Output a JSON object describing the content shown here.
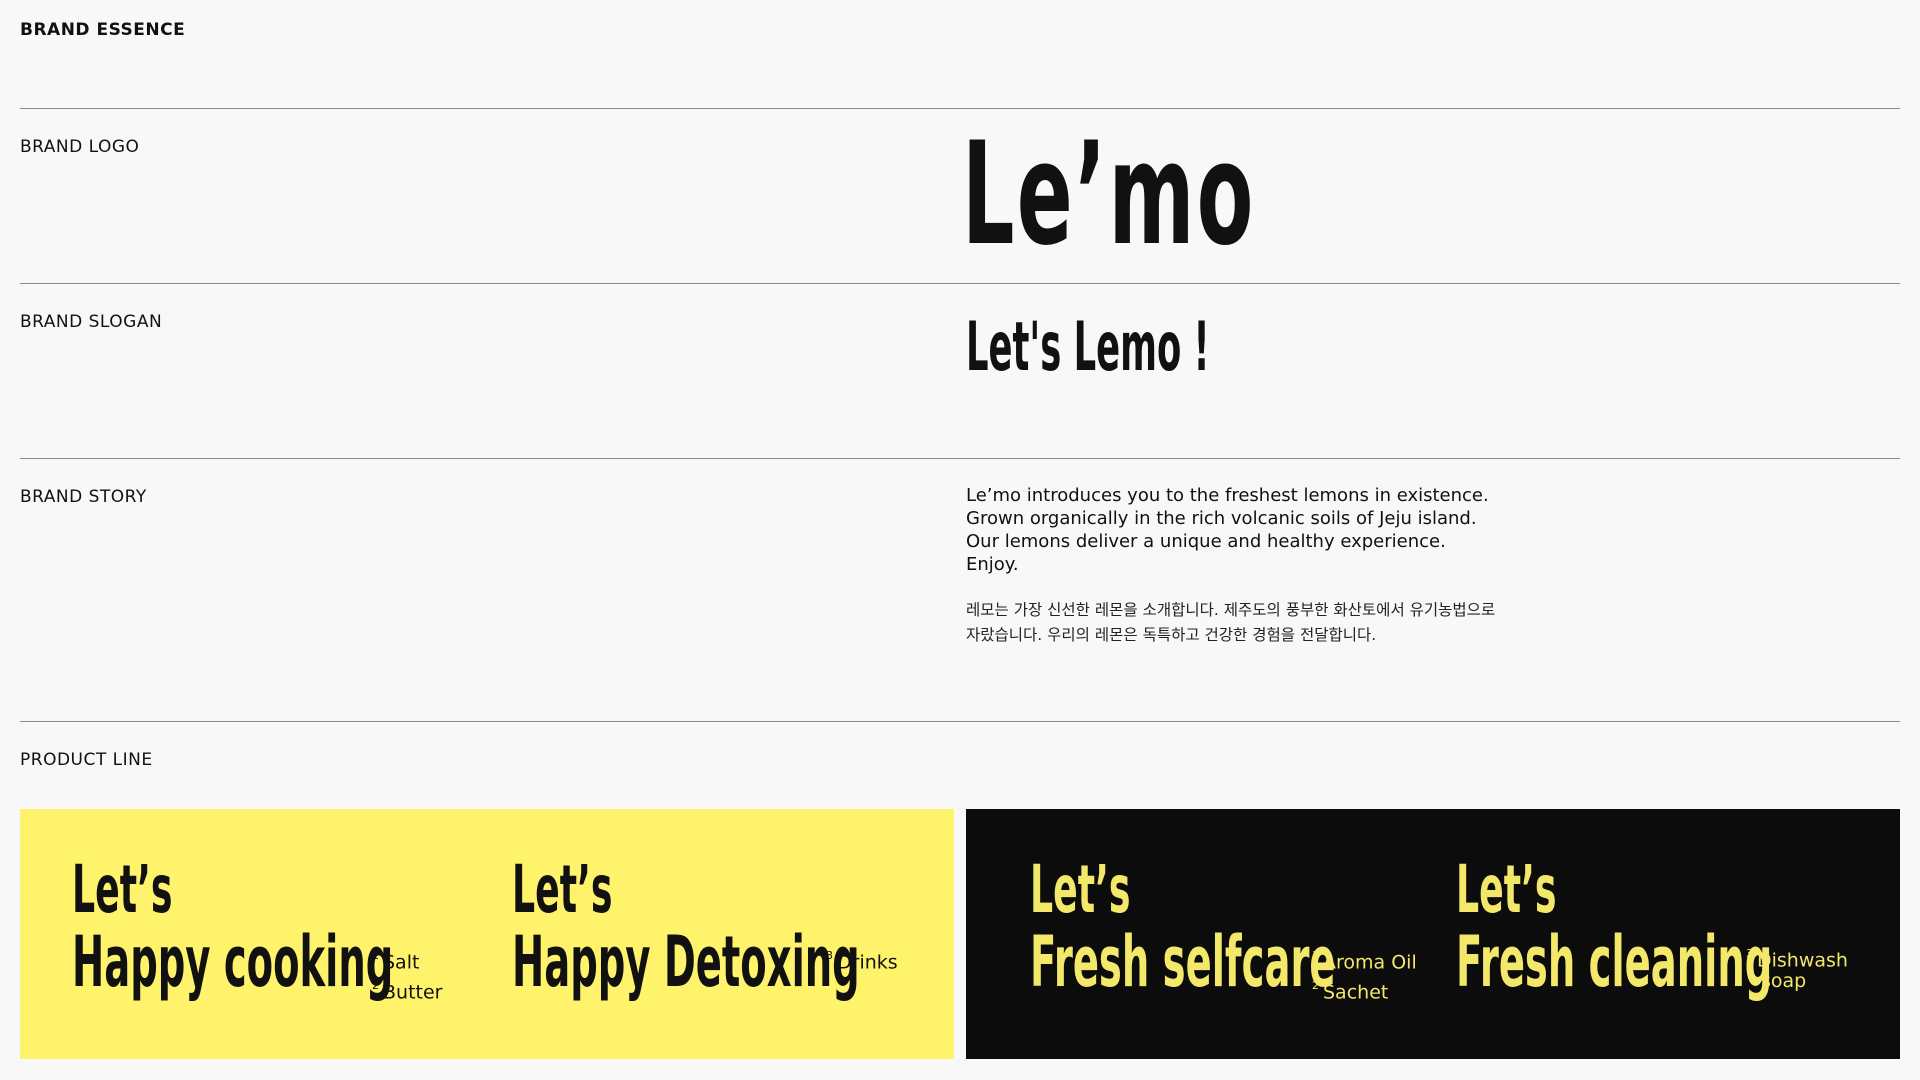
{
  "sections": {
    "essence": "BRAND ESSENCE",
    "logo": "BRAND LOGO",
    "slogan": "BRAND SLOGAN",
    "story": "BRAND STORY",
    "product_line": "PRODUCT LINE"
  },
  "logo_text": "Le’mo",
  "slogan_text": "Let's Lemo !",
  "story": {
    "en": [
      "Le’mo introduces you to the freshest lemons in existence.",
      "Grown organically in the rich volcanic soils of Jeju island.",
      "Our lemons deliver a unique and healthy experience.",
      "Enjoy."
    ],
    "ko": [
      "레모는 가장 신선한 레몬을 소개합니다. 제주도의 풍부한 화산토에서 유기농법으로",
      "자랐습니다. 우리의 레몬은 독특하고 건강한 경험을 전달합니다."
    ]
  },
  "products": {
    "yellow": [
      {
        "lets": "Let’s",
        "name": "Happy cooking",
        "notes": [
          {
            "num": "1",
            "text": "Salt"
          },
          {
            "num": "2",
            "text": "Butter"
          }
        ]
      },
      {
        "lets": "Let’s",
        "name": "Happy Detoxing",
        "notes": [
          {
            "num": "3",
            "text": "Drinks"
          }
        ]
      }
    ],
    "black": [
      {
        "lets": "Let’s",
        "name": "Fresh selfcare",
        "notes": [
          {
            "num": "1",
            "text": "Aroma Oil"
          },
          {
            "num": "2",
            "text": "Sachet"
          }
        ]
      },
      {
        "lets": "Let’s",
        "name": "Fresh cleaning",
        "notes": [
          {
            "num": "3",
            "text": "Dishwash"
          },
          {
            "num": "",
            "text": "soap"
          }
        ]
      }
    ]
  },
  "colors": {
    "background": "#f8f8f8",
    "yellow_panel": "#fff36b",
    "black_panel": "#0c0c0c",
    "accent_text": "#f3e86a"
  }
}
